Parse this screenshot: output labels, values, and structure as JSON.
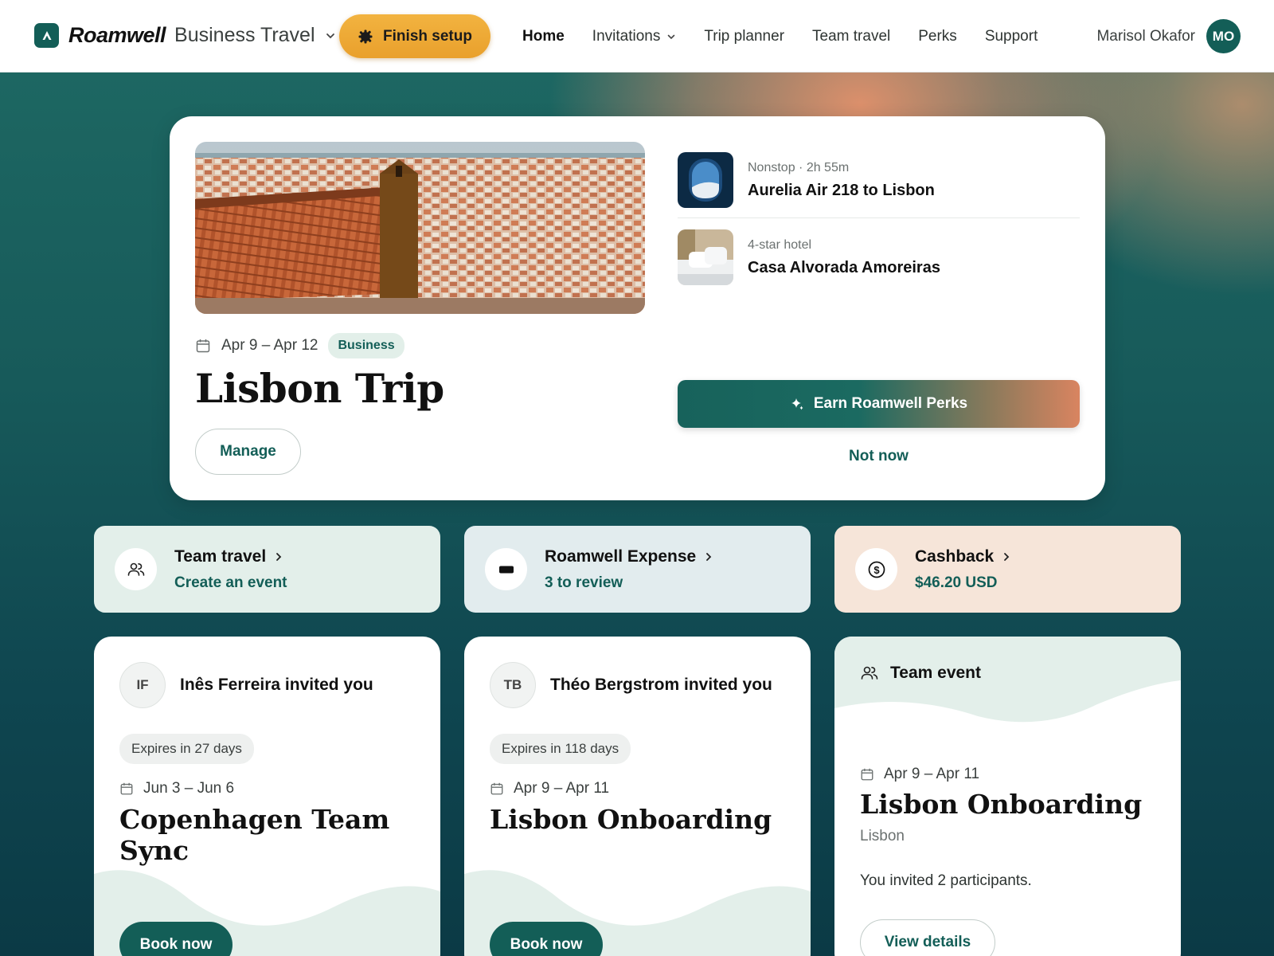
{
  "brand": {
    "name": "Roamwell",
    "product": "Business Travel"
  },
  "header": {
    "finish_setup_label": "Finish setup",
    "nav": [
      {
        "label": "Home",
        "active": true
      },
      {
        "label": "Invitations",
        "has_dropdown": true
      },
      {
        "label": "Trip planner"
      },
      {
        "label": "Team travel"
      },
      {
        "label": "Perks"
      },
      {
        "label": "Support"
      }
    ],
    "user": {
      "name": "Marisol Okafor",
      "initials": "MO"
    }
  },
  "trip": {
    "dates": "Apr 9 – Apr 12",
    "tag": "Business",
    "title": "Lisbon Trip",
    "manage_label": "Manage",
    "flight": {
      "sub": "Nonstop · 2h 55m",
      "title": "Aurelia Air 218 to Lisbon"
    },
    "hotel": {
      "sub": "4-star hotel",
      "title": "Casa Alvorada Amoreiras"
    },
    "perks_label": "Earn Roamwell Perks",
    "not_now_label": "Not now"
  },
  "quick_links": [
    {
      "title": "Team travel",
      "sub": "Create an event",
      "icon": "people-icon",
      "bg": "#e3efea"
    },
    {
      "title": "Roamwell Expense",
      "sub": "3 to review",
      "icon": "card-icon",
      "bg": "#e2ecee"
    },
    {
      "title": "Cashback",
      "sub": "$46.20 USD",
      "icon": "dollar-icon",
      "bg": "#f6e5d9"
    }
  ],
  "invites": [
    {
      "initials": "IF",
      "inviter": "Inês Ferreira invited you",
      "expires": "Expires in 27 days",
      "dates": "Jun 3 – Jun 6",
      "title": "Copenhagen Team Sync",
      "book_label": "Book now"
    },
    {
      "initials": "TB",
      "inviter": "Théo Bergstrom invited you",
      "expires": "Expires in 118 days",
      "dates": "Apr 9 – Apr 11",
      "title": "Lisbon Onboarding",
      "book_label": "Book now"
    }
  ],
  "team_event": {
    "label": "Team event",
    "dates": "Apr 9 – Apr 11",
    "title": "Lisbon Onboarding",
    "city": "Lisbon",
    "description": "You invited 2 participants.",
    "view_label": "View details"
  },
  "colors": {
    "brand_green": "#135e57",
    "accent_orange": "#e9a02c"
  }
}
